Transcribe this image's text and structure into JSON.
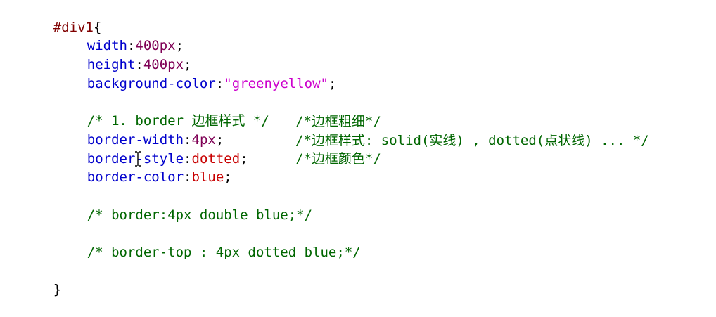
{
  "code": {
    "selector": "#div1",
    "open_brace": "{",
    "close_brace": "}",
    "lines": {
      "width": {
        "prop": "width",
        "colon": ":",
        "value": "400px",
        "semi": ";"
      },
      "height": {
        "prop": "height",
        "colon": ":",
        "value": "400px",
        "semi": ";"
      },
      "bgcolor": {
        "prop": "background-color",
        "colon": ":",
        "value": "\"greenyellow\"",
        "semi": ";"
      },
      "comment1": "/* 1. border 边框样式 */",
      "border_width": {
        "prop": "border-width",
        "colon": ":",
        "value": "4px",
        "semi": ";",
        "comment": "/*边框粗细*/"
      },
      "border_style": {
        "prop": "border-style",
        "colon": ":",
        "value": "dotted",
        "semi": ";",
        "comment": "/*边框样式: solid(实线) , dotted(点状线) ... */"
      },
      "border_color": {
        "prop_a": "border-co",
        "prop_b": "lor",
        "colon": ":",
        "value": "blue",
        "semi": ";",
        "comment": "/*边框颜色*/"
      },
      "comment2": "/* border:4px double blue;*/",
      "comment3": "/* border-top : 4px dotted blue;*/"
    }
  },
  "colors": {
    "selector": "#800000",
    "property": "#0000cc",
    "number": "#7f0055",
    "string": "#cc00cc",
    "keyword": "#c80000",
    "comment": "#006600"
  },
  "cursor": {
    "icon": "i-beam-cursor-icon"
  }
}
